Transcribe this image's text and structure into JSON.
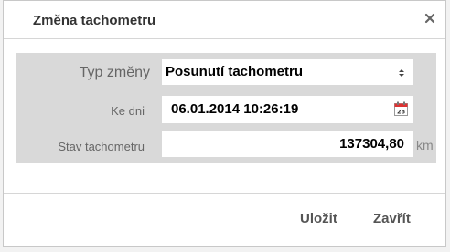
{
  "dialog": {
    "title": "Změna tachometru",
    "close_icon": "close-icon"
  },
  "form": {
    "type_label": "Typ změny",
    "type_value": "Posunutí tachometru",
    "date_label": "Ke dni",
    "date_value": "06.01.2014 10:26:19",
    "date_icon": "calendar-icon",
    "odometer_label": "Stav tachometru",
    "odometer_value": "137304,80",
    "odometer_unit": "km"
  },
  "footer": {
    "save_label": "Uložit",
    "close_label": "Zavřít"
  },
  "colors": {
    "panel_background": "#d9d9d9",
    "label_text": "#666666",
    "button_text": "#555555"
  }
}
